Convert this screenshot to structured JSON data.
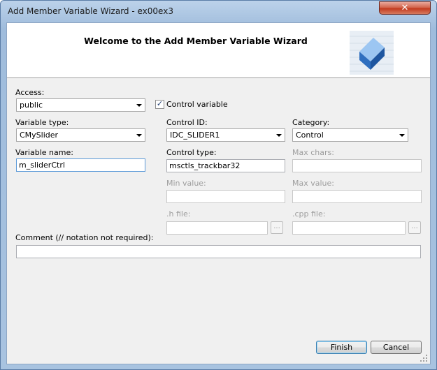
{
  "window": {
    "title": "Add Member Variable Wizard - ex00ex3",
    "close_glyph": "✕"
  },
  "header": {
    "title": "Welcome to the Add Member Variable Wizard"
  },
  "access": {
    "label": "Access:",
    "value": "public"
  },
  "control_variable": {
    "label": "Control variable",
    "checked": true,
    "check_glyph": "✓"
  },
  "variable_type": {
    "label": "Variable type:",
    "value": "CMySlider"
  },
  "control_id": {
    "label": "Control ID:",
    "value": "IDC_SLIDER1"
  },
  "category": {
    "label": "Category:",
    "value": "Control"
  },
  "variable_name": {
    "label": "Variable name:",
    "value": "m_sliderCtrl"
  },
  "control_type": {
    "label": "Control type:",
    "value": "msctls_trackbar32"
  },
  "max_chars": {
    "label": "Max chars:",
    "value": ""
  },
  "min_value": {
    "label": "Min value:",
    "value": ""
  },
  "max_value": {
    "label": "Max value:",
    "value": ""
  },
  "h_file": {
    "label": ".h file:",
    "value": "",
    "browse_label": "..."
  },
  "cpp_file": {
    "label": ".cpp file:",
    "value": "",
    "browse_label": "..."
  },
  "comment": {
    "label": "Comment (// notation not required):",
    "value": ""
  },
  "buttons": {
    "finish": "Finish",
    "cancel": "Cancel"
  },
  "colors": {
    "logo_blue": "#3f7fd0",
    "close_red": "#c2381c"
  }
}
